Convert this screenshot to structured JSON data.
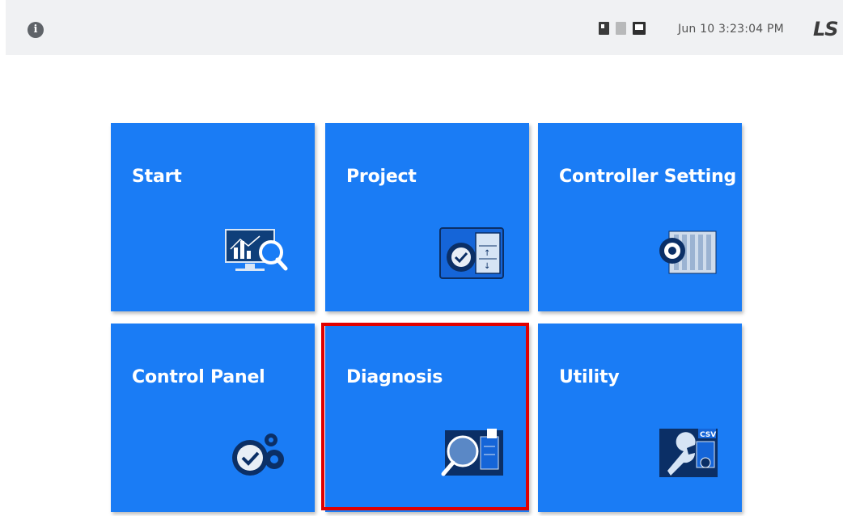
{
  "header": {
    "datetime": "Jun 10 3:23:04 PM",
    "logo_text": "LS"
  },
  "status_icons": [
    "sd-card-icon",
    "memory-card-icon",
    "network-icon"
  ],
  "tiles": [
    {
      "label": "Start",
      "icon": "chart-monitor-search-icon"
    },
    {
      "label": "Project",
      "icon": "gear-check-document-icon"
    },
    {
      "label": "Controller Setting",
      "icon": "gear-plc-rack-icon"
    },
    {
      "label": "Control Panel",
      "icon": "gears-check-icon"
    },
    {
      "label": "Diagnosis",
      "icon": "magnifier-module-icon"
    },
    {
      "label": "Utility",
      "icon": "wrench-csv-icon"
    }
  ],
  "colors": {
    "tile_bg": "#1a7cf5",
    "highlight": "#e00000",
    "topbar": "#f0f1f3"
  }
}
